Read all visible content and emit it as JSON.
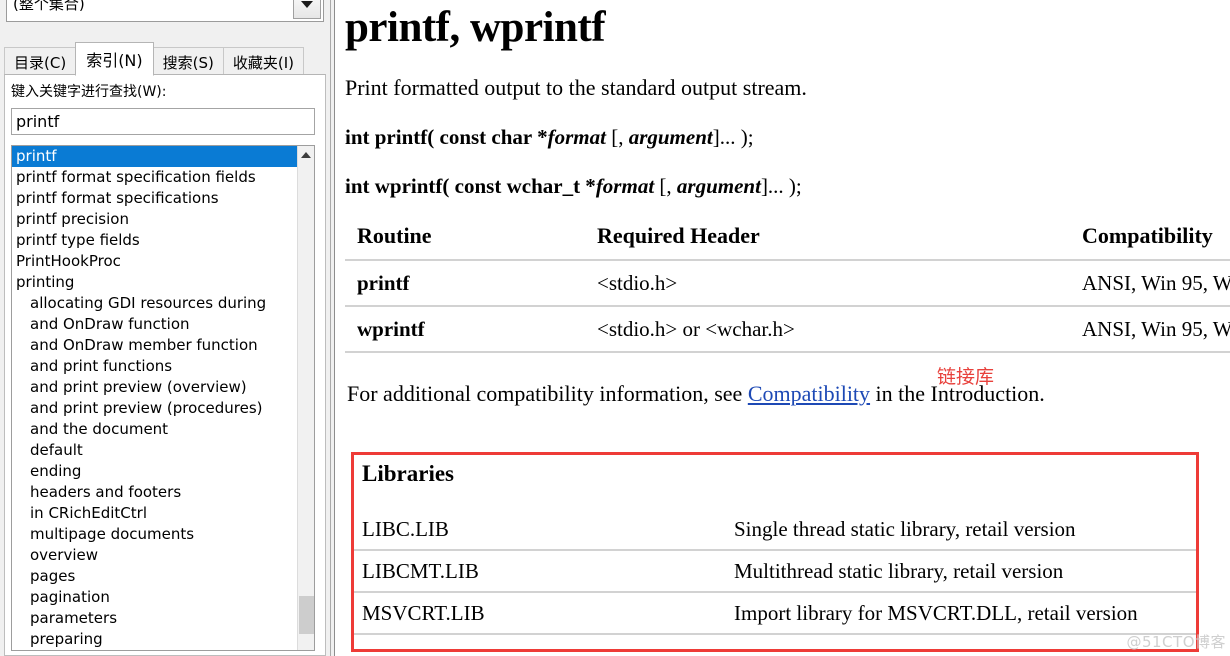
{
  "nav": {
    "collection": {
      "value": "(整个集合)",
      "dropdown_icon": "chevron-down-icon"
    },
    "tabs": [
      {
        "label": "目录(C)",
        "active": false
      },
      {
        "label": "索引(N)",
        "active": true
      },
      {
        "label": "搜索(S)",
        "active": false
      },
      {
        "label": "收藏夹(I)",
        "active": false
      }
    ],
    "keyword_label": "键入关键字进行查找(W):",
    "keyword_input": {
      "value": "printf",
      "placeholder": ""
    },
    "list_items": [
      {
        "label": "printf",
        "indent": false,
        "selected": true
      },
      {
        "label": "printf format specification fields",
        "indent": false,
        "selected": false
      },
      {
        "label": "printf format specifications",
        "indent": false,
        "selected": false
      },
      {
        "label": "printf precision",
        "indent": false,
        "selected": false
      },
      {
        "label": "printf type fields",
        "indent": false,
        "selected": false
      },
      {
        "label": "PrintHookProc",
        "indent": false,
        "selected": false
      },
      {
        "label": "printing",
        "indent": false,
        "selected": false
      },
      {
        "label": "allocating GDI resources during",
        "indent": true,
        "selected": false
      },
      {
        "label": "and OnDraw function",
        "indent": true,
        "selected": false
      },
      {
        "label": "and OnDraw member function",
        "indent": true,
        "selected": false
      },
      {
        "label": "and print functions",
        "indent": true,
        "selected": false
      },
      {
        "label": "and print preview (overview)",
        "indent": true,
        "selected": false
      },
      {
        "label": "and print preview (procedures)",
        "indent": true,
        "selected": false
      },
      {
        "label": "and the document",
        "indent": true,
        "selected": false
      },
      {
        "label": "default",
        "indent": true,
        "selected": false
      },
      {
        "label": "ending",
        "indent": true,
        "selected": false
      },
      {
        "label": "headers and footers",
        "indent": true,
        "selected": false
      },
      {
        "label": "in CRichEditCtrl",
        "indent": true,
        "selected": false
      },
      {
        "label": "multipage documents",
        "indent": true,
        "selected": false
      },
      {
        "label": "overview",
        "indent": true,
        "selected": false
      },
      {
        "label": "pages",
        "indent": true,
        "selected": false
      },
      {
        "label": "pagination",
        "indent": true,
        "selected": false
      },
      {
        "label": "parameters",
        "indent": true,
        "selected": false
      },
      {
        "label": "preparing",
        "indent": true,
        "selected": false
      }
    ],
    "scroll_up_icon": "chevron-up-icon"
  },
  "doc": {
    "title": "printf, wprintf",
    "description": "Print formatted output to the standard output stream.",
    "signatures": [
      {
        "prefix": "int printf( const char *",
        "param": "format",
        "mid": " [, ",
        "param2": "argument",
        "suffix": "]... );"
      },
      {
        "prefix": "int wprintf( const wchar_t *",
        "param": "format",
        "mid": " [, ",
        "param2": "argument",
        "suffix": "]... );"
      }
    ],
    "routine_table": {
      "headers": [
        "Routine",
        "Required Header",
        "Compatibility"
      ],
      "rows": [
        {
          "routine": "printf",
          "header": "<stdio.h>",
          "compatibility": "ANSI, Win 95, W"
        },
        {
          "routine": "wprintf",
          "header": "<stdio.h> or <wchar.h>",
          "compatibility": "ANSI, Win 95, W"
        }
      ]
    },
    "annotation_red": "链接库",
    "compat_note": {
      "before": "For additional compatibility information, see ",
      "link": "Compatibility",
      "after": " in the Introduction."
    },
    "libraries": {
      "title": "Libraries",
      "rows": [
        {
          "name": "LIBC.LIB",
          "description": "Single thread static library, retail version"
        },
        {
          "name": "LIBCMT.LIB",
          "description": "Multithread static library, retail version"
        },
        {
          "name": "MSVCRT.LIB",
          "description": "Import library for MSVCRT.DLL, retail version"
        }
      ]
    }
  },
  "watermark": "@51CTO博客",
  "colors": {
    "selection_blue": "#0a7bd4",
    "annotation_red": "#e8413c",
    "box_red": "#ee3b37",
    "link_blue": "#1d49b5"
  }
}
